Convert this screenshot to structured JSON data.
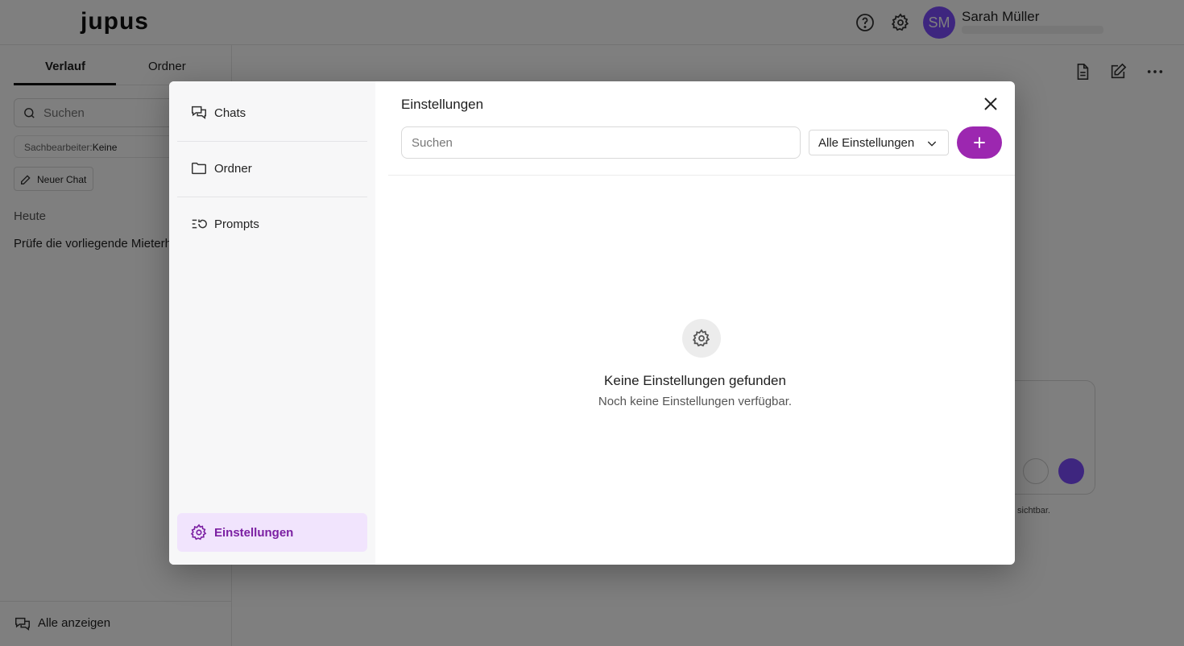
{
  "app": {
    "logo": "jupus",
    "user": {
      "initials": "SM",
      "name": "Sarah Müller"
    }
  },
  "sidebar": {
    "tabs": [
      {
        "label": "Verlauf"
      },
      {
        "label": "Ordner"
      }
    ],
    "search_placeholder": "Suchen",
    "filter": {
      "label": "Sachbearbeiter:",
      "value": "Keine"
    },
    "new_chat_label": "Neuer Chat",
    "section_today": "Heute",
    "history": [
      {
        "title": "Prüfe die vorliegende Mieterh"
      }
    ],
    "show_all_label": "Alle anzeigen"
  },
  "composer": {
    "hint": "sichtbar."
  },
  "modal": {
    "nav": [
      {
        "label": "Chats",
        "icon": "chats-icon"
      },
      {
        "label": "Ordner",
        "icon": "folder-icon"
      },
      {
        "label": "Prompts",
        "icon": "prompts-icon"
      },
      {
        "label": "Einstellungen",
        "icon": "gear-icon",
        "active": true
      }
    ],
    "title": "Einstellungen",
    "search_placeholder": "Suchen",
    "filter_value": "Alle Einstellungen",
    "empty_title": "Keine Einstellungen gefunden",
    "empty_subtitle": "Noch keine Einstellungen verfügbar.",
    "accent_color": "#9c27b0",
    "active_nav_bg": "#f1e4fd"
  }
}
